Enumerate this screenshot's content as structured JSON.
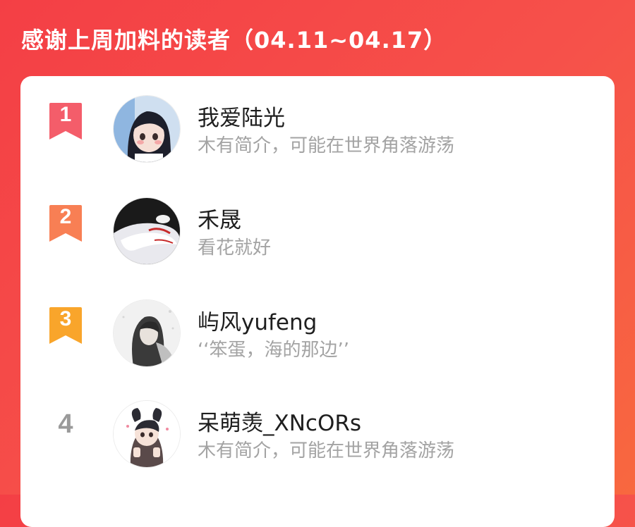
{
  "header": {
    "title": "感谢上周加料的读者（04.11~04.17）"
  },
  "colors": {
    "background": "#f44c47",
    "rank_1": "#f45d6a",
    "rank_2": "#f87f54",
    "rank_3": "#f9a52b",
    "rank_plain": "#9a9a9a"
  },
  "readers": [
    {
      "rank": "1",
      "name": "我爱陆光",
      "bio": "木有简介，可能在世界角落游荡"
    },
    {
      "rank": "2",
      "name": "禾晟",
      "bio": "看花就好"
    },
    {
      "rank": "3",
      "name": "屿风yufeng",
      "bio": "‘‘笨蛋，海的那边’’"
    },
    {
      "rank": "4",
      "name": "呆萌羡_XNcORs",
      "bio": "木有简介，可能在世界角落游荡"
    }
  ]
}
